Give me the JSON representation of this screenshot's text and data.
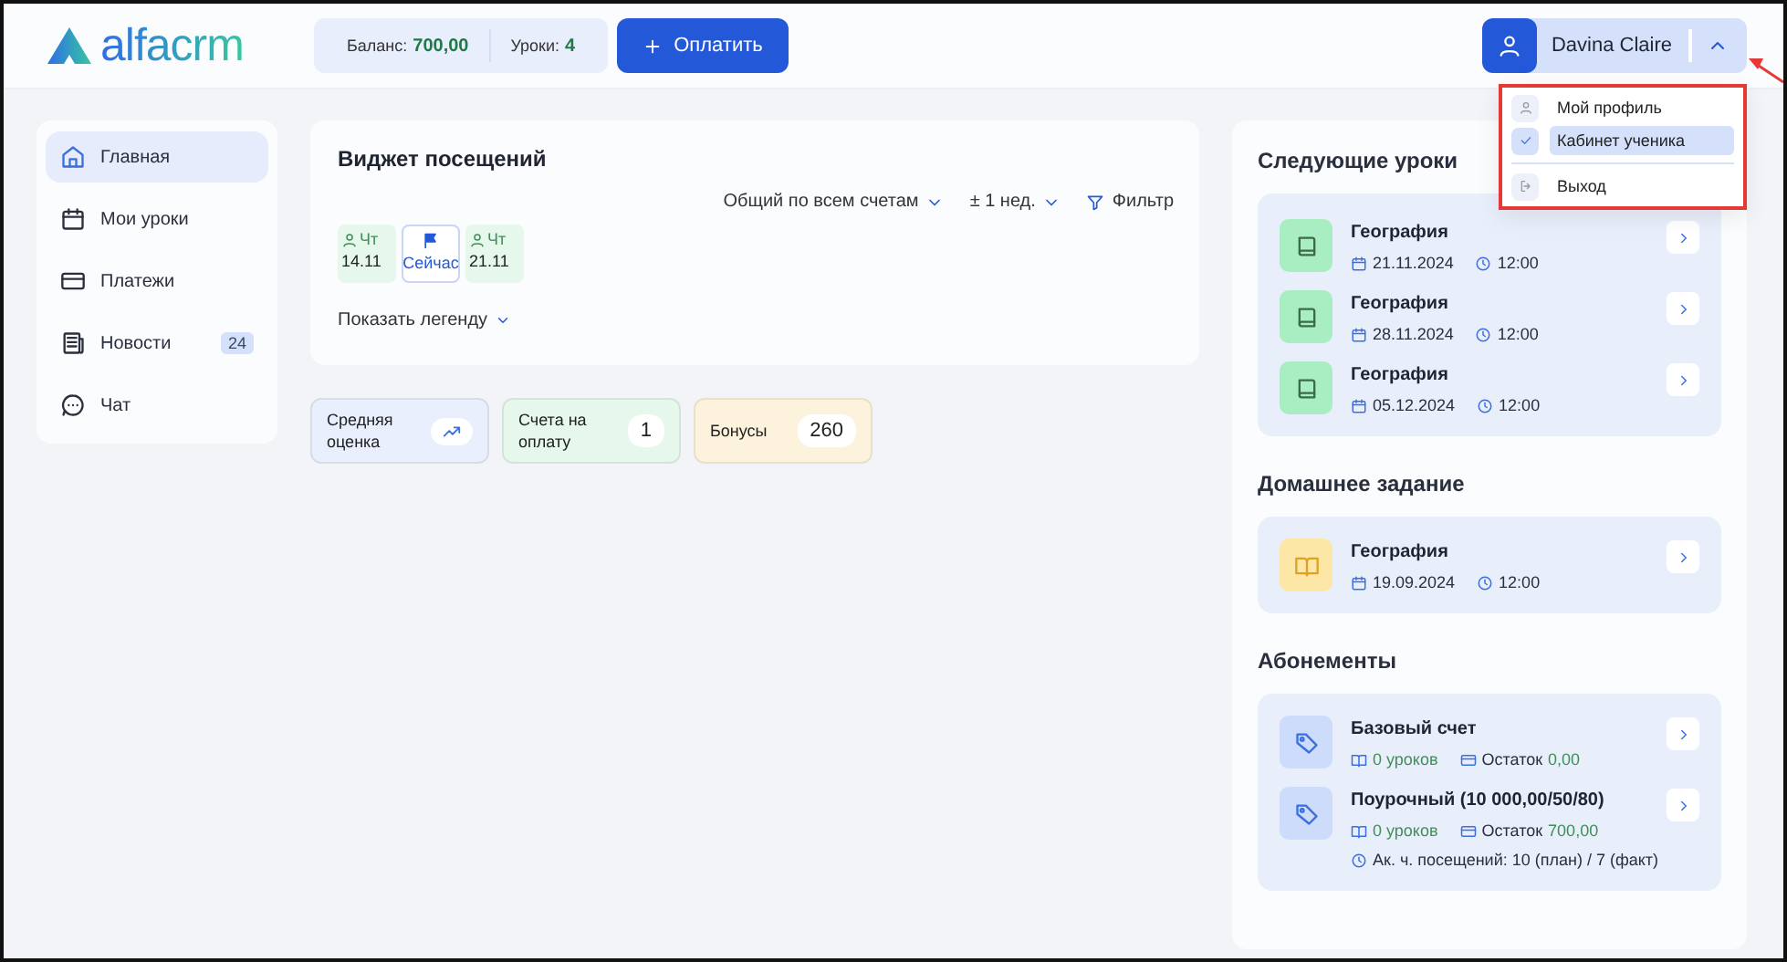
{
  "header": {
    "logo": "alfacrm",
    "balance_label": "Баланс:",
    "balance": "700,00",
    "lessons_label": "Уроки:",
    "lessons": "4",
    "pay_button": "Оплатить",
    "user_name": "Davina Claire",
    "menu_expanded": true
  },
  "user_menu": {
    "items": [
      {
        "label": "Мой профиль",
        "kind": "profile",
        "selected": false
      },
      {
        "label": "Кабинет ученика",
        "kind": "student",
        "selected": true
      },
      {
        "label": "Выход",
        "kind": "logout",
        "selected": false
      }
    ]
  },
  "sidebar": {
    "items": [
      {
        "label": "Главная",
        "kind": "home",
        "selected": true
      },
      {
        "label": "Мои уроки",
        "kind": "calendar",
        "selected": false
      },
      {
        "label": "Платежи",
        "kind": "card",
        "selected": false
      },
      {
        "label": "Новости",
        "kind": "news",
        "selected": false,
        "badge": "24"
      },
      {
        "label": "Чат",
        "kind": "chat",
        "selected": false
      }
    ]
  },
  "attendance_widget": {
    "title": "Виджет посещений",
    "filters": [
      {
        "label": "Общий по всем счетам",
        "kind": "dropdown"
      },
      {
        "label": "± 1 нед.",
        "kind": "dropdown"
      },
      {
        "label": "Фильтр",
        "kind": "filter"
      }
    ],
    "days": [
      {
        "kind": "lesson",
        "weekday": "Чт",
        "date": "14.11"
      },
      {
        "kind": "now",
        "label": "Сейчас"
      },
      {
        "kind": "lesson",
        "weekday": "Чт",
        "date": "21.11"
      }
    ],
    "legend_toggle": "Показать легенду"
  },
  "stats": [
    {
      "label": "Средняя оценка",
      "kind": "trend",
      "color": "#e9effc"
    },
    {
      "label": "Счета на оплату",
      "kind": "value",
      "value": "1",
      "color": "#e6f8ec"
    },
    {
      "label": "Бонусы",
      "kind": "value",
      "value": "260",
      "color": "#fdf3dc"
    }
  ],
  "next_lessons": {
    "title": "Следующие уроки",
    "items": [
      {
        "subject": "География",
        "date": "21.11.2024",
        "time": "12:00"
      },
      {
        "subject": "География",
        "date": "28.11.2024",
        "time": "12:00"
      },
      {
        "subject": "География",
        "date": "05.12.2024",
        "time": "12:00"
      }
    ]
  },
  "homework": {
    "title": "Домашнее задание",
    "items": [
      {
        "subject": "География",
        "date": "19.09.2024",
        "time": "12:00"
      }
    ]
  },
  "subscriptions": {
    "title": "Абонементы",
    "items": [
      {
        "name": "Базовый счет",
        "lessons": "0 уроков",
        "balance_label": "Остаток",
        "balance": "0,00"
      },
      {
        "name": "Поурочный (10 000,00/50/80)",
        "lessons": "0 уроков",
        "balance_label": "Остаток",
        "balance": "700,00",
        "attendance": "Ак. ч. посещений: 10 (план) / 7 (факт)"
      }
    ]
  }
}
